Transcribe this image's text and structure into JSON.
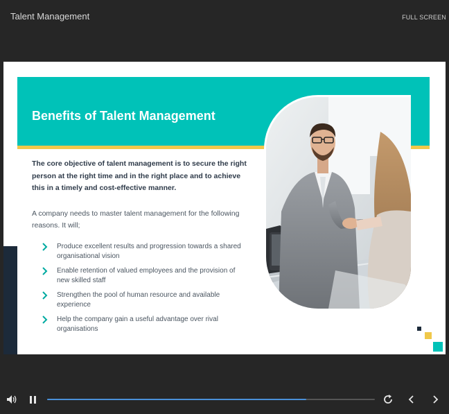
{
  "app": {
    "title": "Talent Management",
    "fullscreen_label": "FULL SCREEN"
  },
  "slide": {
    "title": "Benefits of Talent Management",
    "intro": "The core objective of talent management is to secure the right person at the right time and in the right place and to achieve this in a timely and cost-effective manner.",
    "body": "A company needs to master talent management for the following reasons. It will;",
    "bullets": [
      "Produce excellent results and progression towards a shared organisational vision",
      "Enable retention of valued employees and the provision of new skilled staff",
      "Strengthen the pool of human resource and available experience",
      "Help the company gain a useful advantage over rival organisations"
    ]
  },
  "player": {
    "progress": 0.79
  },
  "colors": {
    "teal": "#00c2b8",
    "yellow": "#f0c84a",
    "navy": "#1c2a3a",
    "progress": "#4a90d9"
  },
  "icons": [
    "volume-icon",
    "pause-icon",
    "replay-icon",
    "chevron-left-icon",
    "chevron-right-icon",
    "chevron-right-bullet-icon"
  ]
}
